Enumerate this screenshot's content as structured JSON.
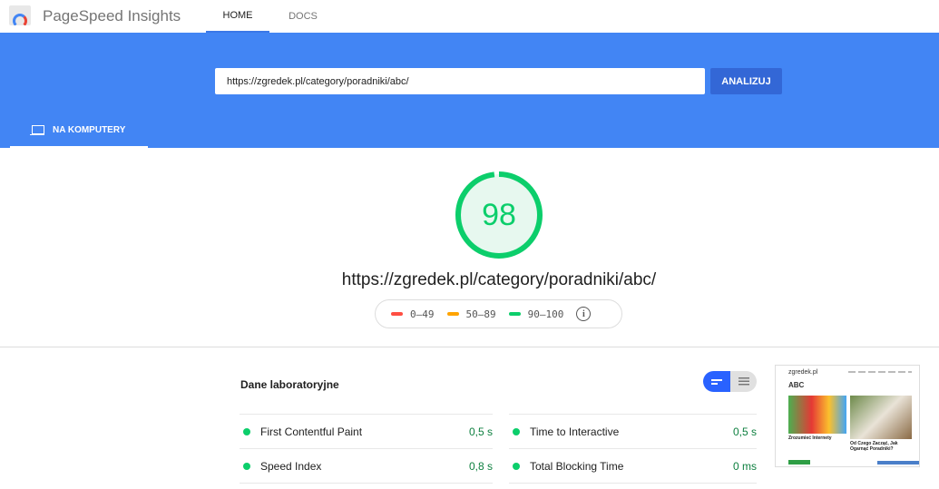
{
  "header": {
    "app_title": "PageSpeed Insights",
    "nav": [
      {
        "label": "HOME",
        "active": true
      },
      {
        "label": "DOCS",
        "active": false
      }
    ]
  },
  "search": {
    "url_value": "https://zgredek.pl/category/poradniki/abc/",
    "analyze_label": "ANALIZUJ"
  },
  "tabs": [
    {
      "label": "NA KOMPUTERY",
      "icon": "laptop-icon",
      "active": true
    }
  ],
  "result": {
    "score": "98",
    "score_color": "#0cce6b",
    "url": "https://zgredek.pl/category/poradniki/abc/"
  },
  "legend": [
    {
      "range": "0–49",
      "color": "#ff4e42"
    },
    {
      "range": "50–89",
      "color": "#ffa400"
    },
    {
      "range": "90–100",
      "color": "#0cce6b"
    }
  ],
  "lab": {
    "title": "Dane laboratoryjne",
    "metrics": [
      {
        "name": "First Contentful Paint",
        "value": "0,5 s"
      },
      {
        "name": "Time to Interactive",
        "value": "0,5 s"
      },
      {
        "name": "Speed Index",
        "value": "0,8 s"
      },
      {
        "name": "Total Blocking Time",
        "value": "0 ms"
      }
    ]
  },
  "thumbnail": {
    "site": "zgredek.pl",
    "heading": "ABC",
    "post1": "Zrozumieć Internety",
    "post2": "Od Czego Zacząć, Jak Ogarnąć Poradniki?"
  }
}
